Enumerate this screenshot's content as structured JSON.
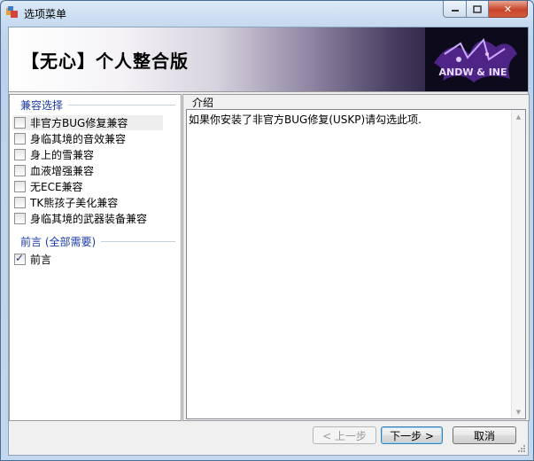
{
  "window": {
    "title": "选项菜单",
    "icon": "app-icon"
  },
  "banner": {
    "title": "【无心】个人整合版",
    "logo": "ANDW & INE"
  },
  "compat_group": {
    "title": "兼容选择",
    "options": [
      {
        "label": "非官方BUG修复兼容",
        "checked": false
      },
      {
        "label": "身临其境的音效兼容",
        "checked": false
      },
      {
        "label": "身上的雪兼容",
        "checked": false
      },
      {
        "label": "血液增强兼容",
        "checked": false
      },
      {
        "label": "无ECE兼容",
        "checked": false
      },
      {
        "label": "TK熊孩子美化兼容",
        "checked": false
      },
      {
        "label": "身临其境的武器装备兼容",
        "checked": false
      }
    ]
  },
  "preface_group": {
    "title": "前言 (全部需要)",
    "options": [
      {
        "label": "前言",
        "checked": true
      }
    ]
  },
  "intro": {
    "title": "介绍",
    "text": "如果你安装了非官方BUG修复(USKP)请勾选此项."
  },
  "buttons": {
    "prev": "< 上一步",
    "next": "下一步 >",
    "cancel": "取消"
  },
  "colors": {
    "group_title": "#1a3aa8",
    "close_button": "#c8452b",
    "banner_dark": "#0c0a18"
  }
}
